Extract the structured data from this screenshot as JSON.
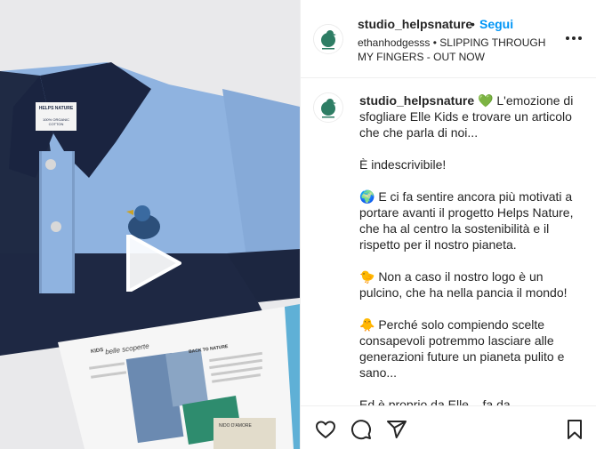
{
  "post": {
    "username": "studio_helpsnature",
    "follow_label": "Segui",
    "separator": "•",
    "audio_text": "ethanhodgesss • SLIPPING THROUGH MY FINGERS - OUT NOW"
  },
  "caption": {
    "username": "studio_helpsnature",
    "heart_emoji": "💚",
    "intro": "L'emozione di sfogliare Elle Kids e trovare un articolo che che parla di noi...",
    "line2": "È indescrivibile!",
    "para1": "🌍 E ci fa sentire ancora più motivati a portare avanti il progetto Helps Nature, che ha al centro la sostenibilità e il rispetto per il nostro pianeta.",
    "para2": "🐤 Non a caso il nostro logo è un pulcino, che ha nella pancia il mondo!",
    "para3": "🐥 Perché solo compiendo scelte consapevoli potremmo lasciare alle generazioni future un pianeta pulito e sano...",
    "para4": "Ed è proprio da Elle... fa da..."
  },
  "media": {
    "label_top": "HELPS NATURE",
    "label_bottom": "100% ORGANIC COTTON",
    "magazine_kicker": "KIDS",
    "magazine_title": "belle scoperte",
    "magazine_section": "BACK TO NATURE",
    "magazine_caption": "NIDO D'AMORE",
    "play_icon": "play-icon"
  },
  "colors": {
    "link_blue": "#0095f6",
    "navy": "#1f2a44",
    "light_blue": "#8fb3e0",
    "logo_green": "#2e7d64"
  },
  "icons": [
    "heart-icon",
    "comment-icon",
    "share-icon",
    "bookmark-icon",
    "more-icon"
  ]
}
